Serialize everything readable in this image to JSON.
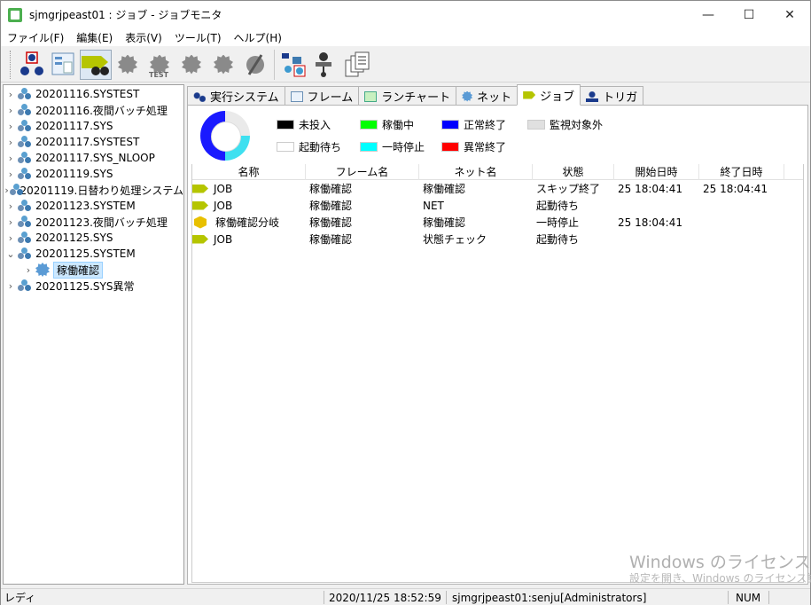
{
  "window": {
    "title": "sjmgrjpeast01 : ジョブ - ジョブモニタ",
    "controls": {
      "minimize": "—",
      "maximize": "☐",
      "close": "✕"
    }
  },
  "menu": [
    "ファイル(F)",
    "編集(E)",
    "表示(V)",
    "ツール(T)",
    "ヘルプ(H)"
  ],
  "toolbar": {
    "test_label": "TEST",
    "buttons": [
      "start-icon",
      "frame-view-icon",
      "binoculars-icon",
      "gear-run-icon",
      "gear-test-icon",
      "gear-forward-icon",
      "gear-stop-icon",
      "slash-icon",
      "tree-icon",
      "person-node-icon",
      "documents-icon"
    ]
  },
  "tree": {
    "items": [
      {
        "label": "20201116.SYSTEST"
      },
      {
        "label": "20201116.夜間バッチ処理"
      },
      {
        "label": "20201117.SYS"
      },
      {
        "label": "20201117.SYSTEST"
      },
      {
        "label": "20201117.SYS_NLOOP"
      },
      {
        "label": "20201119.SYS"
      },
      {
        "label": "20201119.日替わり処理システム"
      },
      {
        "label": "20201123.SYSTEM"
      },
      {
        "label": "20201123.夜間バッチ処理"
      },
      {
        "label": "20201125.SYS"
      },
      {
        "label": "20201125.SYSTEM"
      },
      {
        "label": "稼働確認"
      },
      {
        "label": "20201125.SYS異常"
      }
    ]
  },
  "tabs": [
    {
      "label": "実行システム"
    },
    {
      "label": "フレーム"
    },
    {
      "label": "ランチャート"
    },
    {
      "label": "ネット"
    },
    {
      "label": "ジョブ"
    },
    {
      "label": "トリガ"
    }
  ],
  "legend": [
    {
      "label": "未投入",
      "color": "#000000"
    },
    {
      "label": "稼働中",
      "color": "#00ff00"
    },
    {
      "label": "正常終了",
      "color": "#0000ff"
    },
    {
      "label": "監視対象外",
      "color": "#e0e0e0"
    },
    {
      "label": "起動待ち",
      "color": "#ffffff"
    },
    {
      "label": "一時停止",
      "color": "#00ffff"
    },
    {
      "label": "異常終了",
      "color": "#ff0000"
    }
  ],
  "table": {
    "columns": [
      "名称",
      "フレーム名",
      "ネット名",
      "状態",
      "開始日時",
      "終了日時"
    ],
    "rows": [
      {
        "icon": "job-icon",
        "name": "JOB",
        "frame": "稼働確認",
        "net": "稼働確認",
        "status": "スキップ終了",
        "start": "25 18:04:41",
        "end": "25 18:04:41"
      },
      {
        "icon": "job-icon",
        "name": "JOB",
        "frame": "稼働確認",
        "net": "NET",
        "status": "起動待ち",
        "start": "",
        "end": ""
      },
      {
        "icon": "branch-icon",
        "name": "稼働確認分岐",
        "frame": "稼働確認",
        "net": "稼働確認",
        "status": "一時停止",
        "start": "25 18:04:41",
        "end": ""
      },
      {
        "icon": "job-icon",
        "name": "JOB",
        "frame": "稼働確認",
        "net": "状態チェック",
        "status": "起動待ち",
        "start": "",
        "end": ""
      }
    ]
  },
  "watermark": {
    "line1": "Windows のライセンス認証",
    "line2": "設定を開き、Windows のライセンス認証"
  },
  "statusbar": {
    "ready": "レディ",
    "datetime": "2020/11/25 18:52:59",
    "user": "sjmgrjpeast01:senju[Administrators]",
    "num": "NUM"
  }
}
